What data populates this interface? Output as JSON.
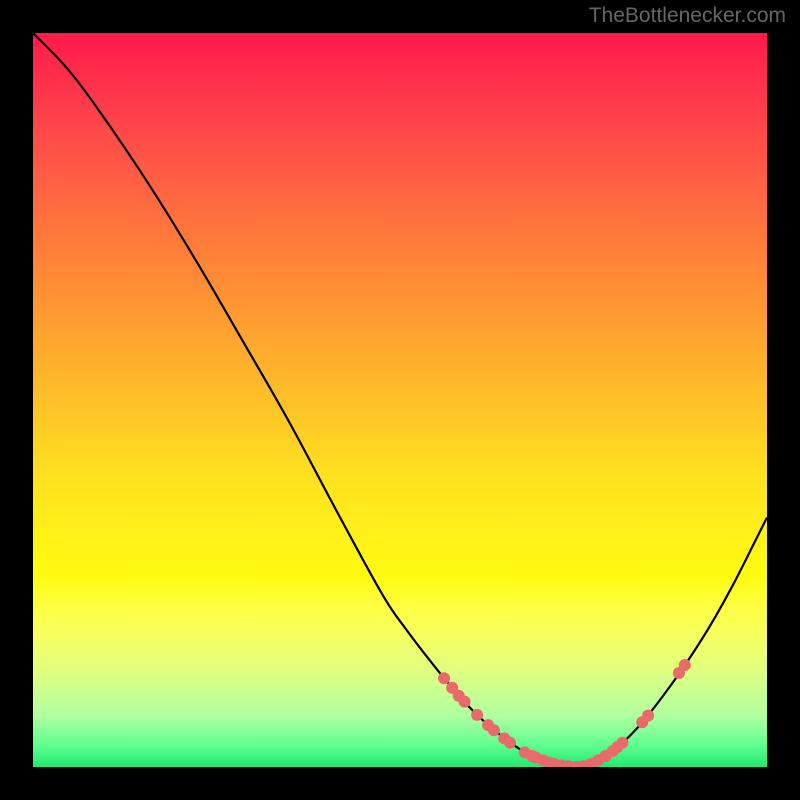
{
  "watermark": "TheBottlenecker.com",
  "chart_data": {
    "type": "line",
    "title": "",
    "xlabel": "",
    "ylabel": "",
    "xlim": [
      0,
      100
    ],
    "ylim": [
      0,
      100
    ],
    "curve": [
      {
        "x": 0.0,
        "y": 100.0
      },
      {
        "x": 4.8,
        "y": 95.0
      },
      {
        "x": 9.5,
        "y": 88.7
      },
      {
        "x": 15.9,
        "y": 79.2
      },
      {
        "x": 22.2,
        "y": 69.0
      },
      {
        "x": 28.6,
        "y": 58.0
      },
      {
        "x": 34.9,
        "y": 47.0
      },
      {
        "x": 41.3,
        "y": 35.0
      },
      {
        "x": 47.6,
        "y": 23.5
      },
      {
        "x": 50.8,
        "y": 18.8
      },
      {
        "x": 54.0,
        "y": 14.6
      },
      {
        "x": 57.1,
        "y": 10.8
      },
      {
        "x": 60.3,
        "y": 7.3
      },
      {
        "x": 63.5,
        "y": 4.5
      },
      {
        "x": 66.7,
        "y": 2.2
      },
      {
        "x": 69.8,
        "y": 0.8
      },
      {
        "x": 72.0,
        "y": 0.2
      },
      {
        "x": 74.5,
        "y": 0.0
      },
      {
        "x": 76.2,
        "y": 0.5
      },
      {
        "x": 79.4,
        "y": 2.5
      },
      {
        "x": 82.5,
        "y": 5.5
      },
      {
        "x": 85.7,
        "y": 9.5
      },
      {
        "x": 88.9,
        "y": 14.0
      },
      {
        "x": 92.1,
        "y": 19.0
      },
      {
        "x": 95.2,
        "y": 24.5
      },
      {
        "x": 98.4,
        "y": 30.8
      },
      {
        "x": 100.0,
        "y": 34.0
      }
    ],
    "markers": [
      {
        "x": 56.0,
        "y": 12.1
      },
      {
        "x": 57.1,
        "y": 10.8
      },
      {
        "x": 58.0,
        "y": 9.7
      },
      {
        "x": 58.8,
        "y": 8.9
      },
      {
        "x": 60.5,
        "y": 7.1
      },
      {
        "x": 62.0,
        "y": 5.7
      },
      {
        "x": 62.8,
        "y": 5.0
      },
      {
        "x": 64.2,
        "y": 3.9
      },
      {
        "x": 65.0,
        "y": 3.3
      },
      {
        "x": 67.0,
        "y": 2.0
      },
      {
        "x": 68.0,
        "y": 1.5
      },
      {
        "x": 68.5,
        "y": 1.3
      },
      {
        "x": 69.5,
        "y": 0.9
      },
      {
        "x": 70.3,
        "y": 0.6
      },
      {
        "x": 71.0,
        "y": 0.4
      },
      {
        "x": 72.0,
        "y": 0.2
      },
      {
        "x": 73.0,
        "y": 0.1
      },
      {
        "x": 74.0,
        "y": 0.0
      },
      {
        "x": 75.0,
        "y": 0.1
      },
      {
        "x": 76.0,
        "y": 0.4
      },
      {
        "x": 77.0,
        "y": 0.9
      },
      {
        "x": 78.0,
        "y": 1.5
      },
      {
        "x": 79.0,
        "y": 2.2
      },
      {
        "x": 79.6,
        "y": 2.7
      },
      {
        "x": 80.3,
        "y": 3.3
      },
      {
        "x": 83.0,
        "y": 6.1
      },
      {
        "x": 83.8,
        "y": 7.0
      },
      {
        "x": 88.0,
        "y": 12.8
      },
      {
        "x": 88.8,
        "y": 13.9
      }
    ],
    "marker_color": "#e86a6a",
    "curve_color": "#000000"
  }
}
